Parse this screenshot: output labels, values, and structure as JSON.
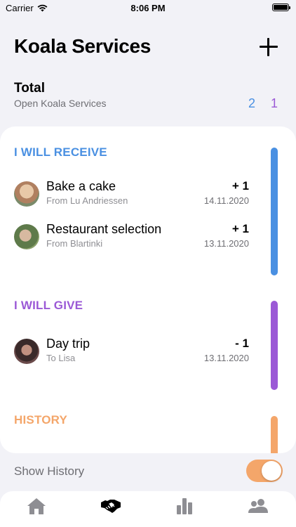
{
  "status_bar": {
    "carrier": "Carrier",
    "time": "8:06 PM",
    "wifi_icon": "wifi-icon",
    "battery_icon": "battery-icon"
  },
  "header": {
    "title": "Koala Services",
    "add_icon": "plus-icon"
  },
  "total": {
    "label": "Total",
    "subtitle": "Open Koala Services",
    "receive_count": "2",
    "give_count": "1"
  },
  "colors": {
    "receive": "#4a90e2",
    "give": "#9b59d6",
    "history": "#f4a66a"
  },
  "sections": {
    "receive": {
      "title": "I WILL RECEIVE",
      "items": [
        {
          "title": "Bake a cake",
          "subtitle": "From Lu Andriessen",
          "amount": "+ 1",
          "date": "14.11.2020"
        },
        {
          "title": "Restaurant selection",
          "subtitle": "From Blartinki",
          "amount": "+ 1",
          "date": "13.11.2020"
        }
      ]
    },
    "give": {
      "title": "I WILL GIVE",
      "items": [
        {
          "title": "Day trip",
          "subtitle": "To Lisa",
          "amount": "- 1",
          "date": "13.11.2020"
        }
      ]
    },
    "history": {
      "title": "HISTORY"
    }
  },
  "show_history": {
    "label": "Show History",
    "enabled": true
  },
  "tabs": [
    {
      "icon": "home-icon",
      "active": false
    },
    {
      "icon": "handshake-icon",
      "active": true
    },
    {
      "icon": "bar-chart-icon",
      "active": false
    },
    {
      "icon": "people-icon",
      "active": false
    }
  ]
}
